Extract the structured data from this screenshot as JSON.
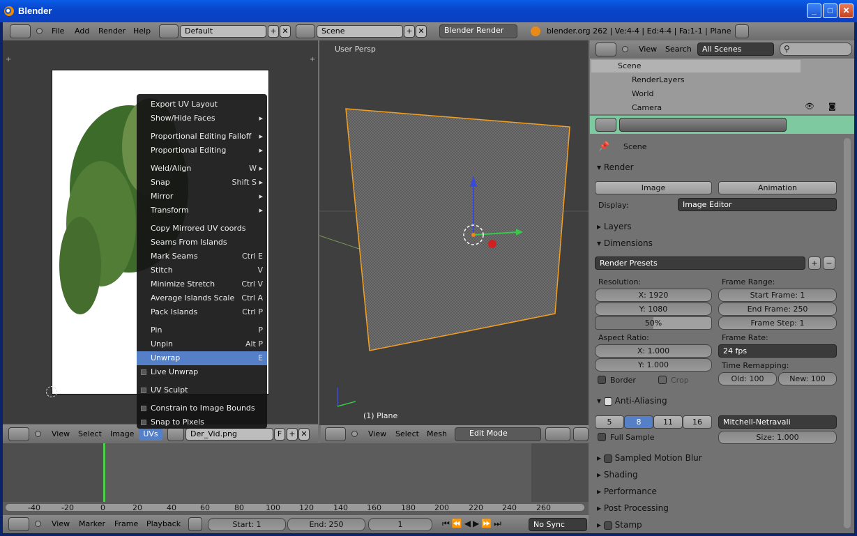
{
  "window": {
    "title": "Blender",
    "btn_min": "_",
    "btn_max": "□",
    "btn_close": "✕"
  },
  "topbar": {
    "menus": [
      "File",
      "Add",
      "Render",
      "Help"
    ],
    "layout": "Default",
    "scene": "Scene",
    "engine": "Blender Render",
    "stats": "blender.org 262 | Ve:4-4 | Ed:4-4 | Fa:1-1 | Plane"
  },
  "viewport": {
    "label": "User Persp",
    "object": "(1) Plane",
    "header": {
      "menus": [
        "View",
        "Select",
        "Mesh"
      ],
      "mode": "Edit Mode"
    }
  },
  "uv_editor": {
    "header": {
      "menus": [
        "View",
        "Select",
        "Image",
        "UVs"
      ],
      "image": "Der_Vid.png",
      "fake": "F"
    }
  },
  "context_menu": {
    "items": [
      {
        "label": "Export UV Layout",
        "shortcut": "",
        "sub": false
      },
      {
        "label": "Show/Hide Faces",
        "shortcut": "",
        "sub": true
      },
      {
        "label": "Proportional Editing Falloff",
        "shortcut": "",
        "sub": true
      },
      {
        "label": "Proportional Editing",
        "shortcut": "",
        "sub": true
      },
      {
        "label": "Weld/Align",
        "shortcut": "W",
        "sub": true
      },
      {
        "label": "Snap",
        "shortcut": "Shift S",
        "sub": true
      },
      {
        "label": "Mirror",
        "shortcut": "",
        "sub": true
      },
      {
        "label": "Transform",
        "shortcut": "",
        "sub": true
      },
      {
        "label": "Copy Mirrored UV coords",
        "shortcut": ""
      },
      {
        "label": "Seams From Islands",
        "shortcut": ""
      },
      {
        "label": "Mark Seams",
        "shortcut": "Ctrl E"
      },
      {
        "label": "Stitch",
        "shortcut": "V"
      },
      {
        "label": "Minimize Stretch",
        "shortcut": "Ctrl V"
      },
      {
        "label": "Average Islands Scale",
        "shortcut": "Ctrl A"
      },
      {
        "label": "Pack Islands",
        "shortcut": "Ctrl P"
      },
      {
        "label": "Pin",
        "shortcut": "P"
      },
      {
        "label": "Unpin",
        "shortcut": "Alt P"
      },
      {
        "label": "Unwrap",
        "shortcut": "E",
        "highlighted": true
      },
      {
        "label": "Live Unwrap",
        "shortcut": "",
        "check": true
      },
      {
        "label": "UV Sculpt",
        "shortcut": "",
        "check": true
      },
      {
        "label": "Constrain to Image Bounds",
        "shortcut": "",
        "check": true
      },
      {
        "label": "Snap to Pixels",
        "shortcut": "",
        "check": true
      }
    ]
  },
  "timeline": {
    "ticks": [
      "-40",
      "-20",
      "0",
      "20",
      "40",
      "60",
      "80",
      "100",
      "120",
      "140",
      "160",
      "180",
      "200",
      "220",
      "240",
      "260"
    ],
    "menus": [
      "View",
      "Marker",
      "Frame",
      "Playback"
    ],
    "start": "Start: 1",
    "end": "End: 250",
    "current": "1",
    "sync": "No Sync"
  },
  "outliner": {
    "menus": [
      "View",
      "Search"
    ],
    "filter": "All Scenes",
    "items": [
      "Scene",
      "RenderLayers",
      "World",
      "Camera"
    ]
  },
  "properties": {
    "context": "Scene",
    "render": {
      "title": "Render",
      "image_btn": "Image",
      "anim_btn": "Animation",
      "display_label": "Display:",
      "display_value": "Image Editor"
    },
    "layers": "Layers",
    "dimensions": {
      "title": "Dimensions",
      "presets": "Render Presets",
      "resolution": "Resolution:",
      "res_x": "X: 1920",
      "res_y": "Y: 1080",
      "percent": "50%",
      "frame_range": "Frame Range:",
      "start": "Start Frame: 1",
      "end": "End Frame: 250",
      "step": "Frame Step: 1",
      "aspect": "Aspect Ratio:",
      "asp_x": "X: 1.000",
      "asp_y": "Y: 1.000",
      "frame_rate": "Frame Rate:",
      "fps": "24 fps",
      "time_remap": "Time Remapping:",
      "old": "Old: 100",
      "new": "New: 100",
      "border": "Border",
      "crop": "Crop"
    },
    "aa": {
      "title": "Anti-Aliasing",
      "samples": [
        "5",
        "8",
        "11",
        "16"
      ],
      "selected": "8",
      "filter": "Mitchell-Netravali",
      "full_sample": "Full Sample",
      "size": "Size: 1.000"
    },
    "panels": [
      "Sampled Motion Blur",
      "Shading",
      "Performance",
      "Post Processing",
      "Stamp"
    ]
  }
}
